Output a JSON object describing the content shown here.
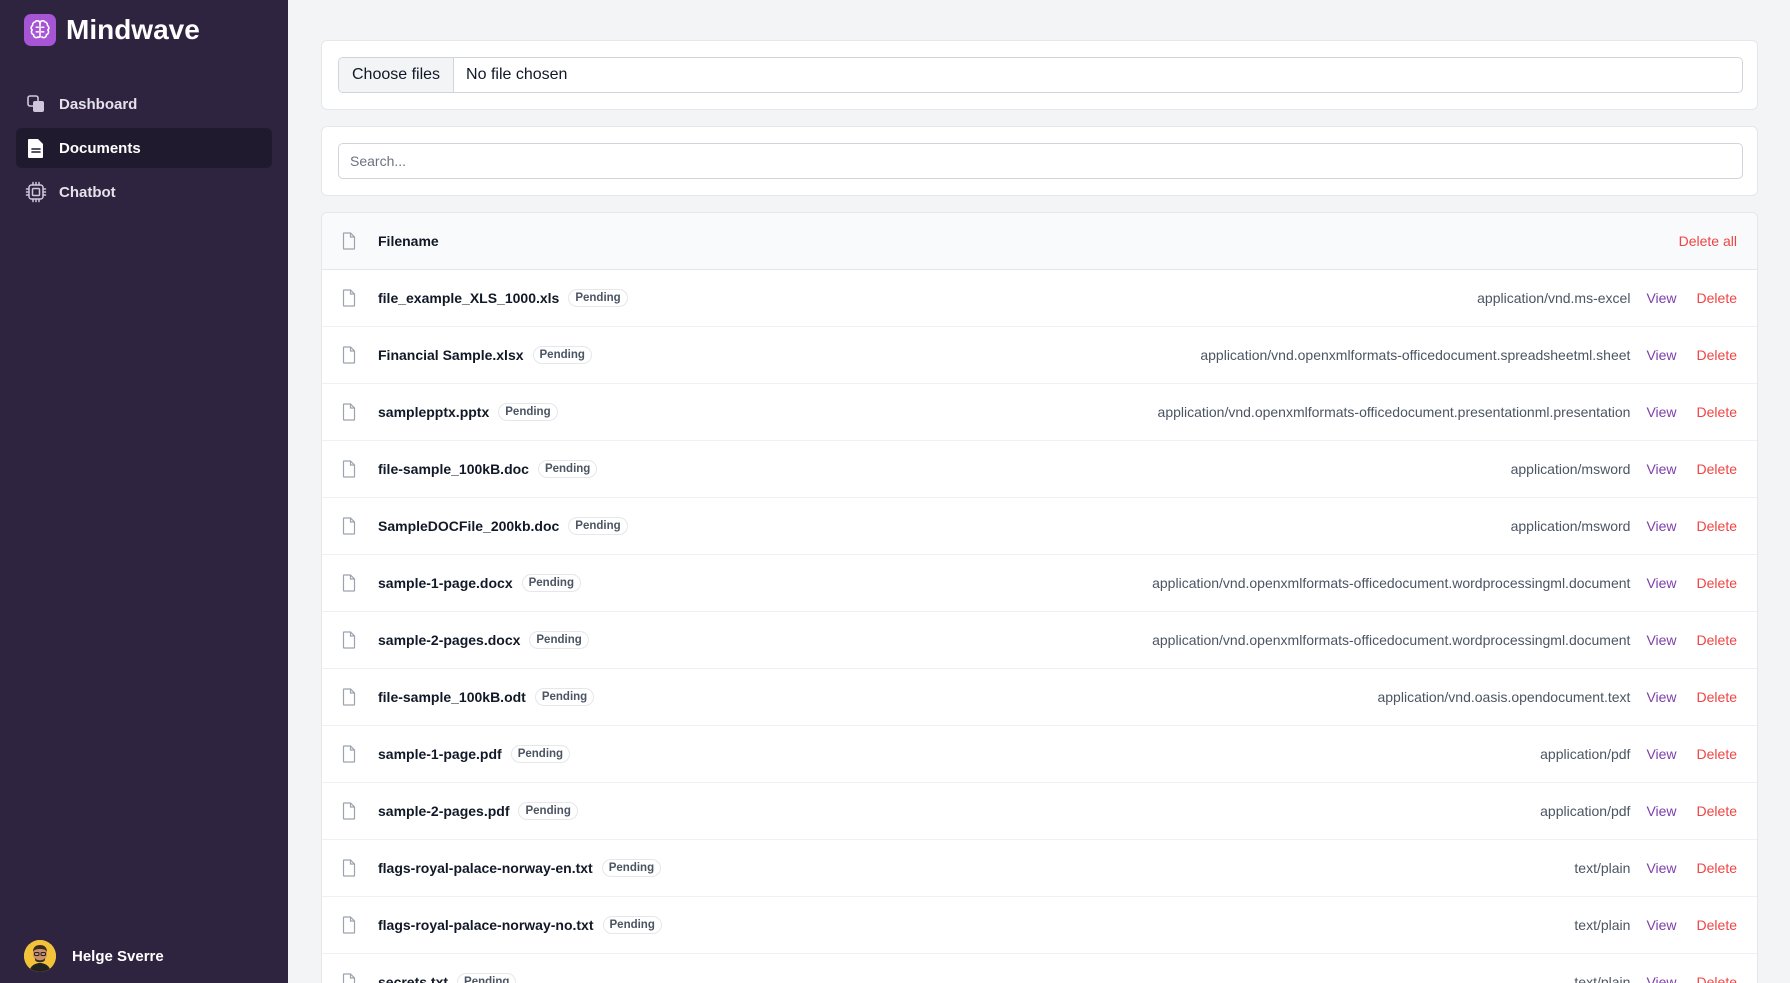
{
  "app": {
    "name": "Mindwave",
    "logo_icon": "brain-icon",
    "accent": "#a655d4"
  },
  "sidebar": {
    "items": [
      {
        "label": "Dashboard",
        "icon": "dashboard-icon",
        "active": false
      },
      {
        "label": "Documents",
        "icon": "document-icon",
        "active": true
      },
      {
        "label": "Chatbot",
        "icon": "chip-icon",
        "active": false
      }
    ],
    "user": {
      "name": "Helge Sverre"
    }
  },
  "upload": {
    "button_label": "Choose files",
    "status": "No file chosen"
  },
  "search": {
    "placeholder": "Search...",
    "value": ""
  },
  "table": {
    "header_label": "Filename",
    "delete_all_label": "Delete all",
    "view_label": "View",
    "delete_label": "Delete",
    "rows": [
      {
        "filename": "file_example_XLS_1000.xls",
        "status": "Pending",
        "mime": "application/vnd.ms-excel"
      },
      {
        "filename": "Financial Sample.xlsx",
        "status": "Pending",
        "mime": "application/vnd.openxmlformats-officedocument.spreadsheetml.sheet"
      },
      {
        "filename": "samplepptx.pptx",
        "status": "Pending",
        "mime": "application/vnd.openxmlformats-officedocument.presentationml.presentation"
      },
      {
        "filename": "file-sample_100kB.doc",
        "status": "Pending",
        "mime": "application/msword"
      },
      {
        "filename": "SampleDOCFile_200kb.doc",
        "status": "Pending",
        "mime": "application/msword"
      },
      {
        "filename": "sample-1-page.docx",
        "status": "Pending",
        "mime": "application/vnd.openxmlformats-officedocument.wordprocessingml.document"
      },
      {
        "filename": "sample-2-pages.docx",
        "status": "Pending",
        "mime": "application/vnd.openxmlformats-officedocument.wordprocessingml.document"
      },
      {
        "filename": "file-sample_100kB.odt",
        "status": "Pending",
        "mime": "application/vnd.oasis.opendocument.text"
      },
      {
        "filename": "sample-1-page.pdf",
        "status": "Pending",
        "mime": "application/pdf"
      },
      {
        "filename": "sample-2-pages.pdf",
        "status": "Pending",
        "mime": "application/pdf"
      },
      {
        "filename": "flags-royal-palace-norway-en.txt",
        "status": "Pending",
        "mime": "text/plain"
      },
      {
        "filename": "flags-royal-palace-norway-no.txt",
        "status": "Pending",
        "mime": "text/plain"
      },
      {
        "filename": "secrets.txt",
        "status": "Pending",
        "mime": "text/plain"
      }
    ]
  }
}
